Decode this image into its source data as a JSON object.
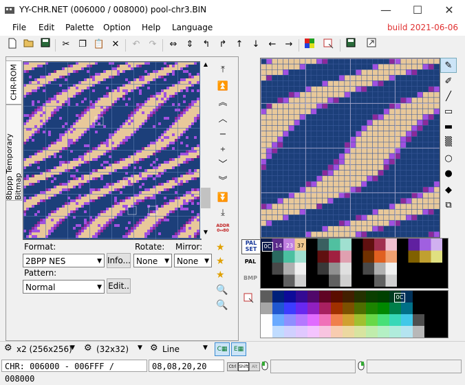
{
  "window": {
    "title": "YY-CHR.NET (006000 / 008000) pool-chr3.BIN",
    "minimize": "—",
    "maximize": "☐",
    "close": "✕"
  },
  "menu": {
    "items": [
      "File",
      "Edit",
      "Palette",
      "Option",
      "Help",
      "Language"
    ],
    "build": "build 2021-06-06"
  },
  "toolbar": {
    "icons": [
      "new-icon",
      "open-icon",
      "save-icon",
      "cut-icon",
      "copy-icon",
      "paste-icon",
      "clear-icon",
      "undo-icon",
      "redo-icon",
      "flip-h-icon",
      "flip-v-icon",
      "rotate-left-icon",
      "rotate-right-icon",
      "shift-up-icon",
      "shift-down-icon",
      "shift-left-icon",
      "shift-right-icon",
      "palette-icon",
      "edit-icon",
      "save-palette-icon",
      "jump-icon"
    ]
  },
  "side_tabs": {
    "chr_rom": "CHR-ROM",
    "bitmap": "8bppp Temporary Bitmap"
  },
  "format": {
    "label": "Format:",
    "value": "2BPP NES",
    "info_button": "Info..."
  },
  "rotate": {
    "label": "Rotate:",
    "value": "None"
  },
  "mirror": {
    "label": "Mirror:",
    "value": "None"
  },
  "pattern": {
    "label": "Pattern:",
    "value": "Normal",
    "edit_button": "Edit.."
  },
  "addr": {
    "line1": "ADDR",
    "line2": "0↔80"
  },
  "pal_labels": {
    "palset": "PAL SET",
    "pal": "PAL",
    "bmp": "BMP"
  },
  "palette_numbers": [
    "0C",
    "14",
    "23",
    "37"
  ],
  "palette_highlight": "0C",
  "status": {
    "zoom": "x2 (256x256)",
    "grid": "(32x32)",
    "mode": "Line",
    "chr_range": "CHR: 006000 - 006FFF / 008000",
    "values": "08,08,20,20",
    "keys": [
      "Ctrl",
      "Shift",
      "Alt"
    ]
  },
  "colors": {
    "navy": "#1c3f7a",
    "tan": "#e8c89a",
    "purple": "#a050e0",
    "magenta": "#8a2a9a",
    "build": "#e03030"
  }
}
